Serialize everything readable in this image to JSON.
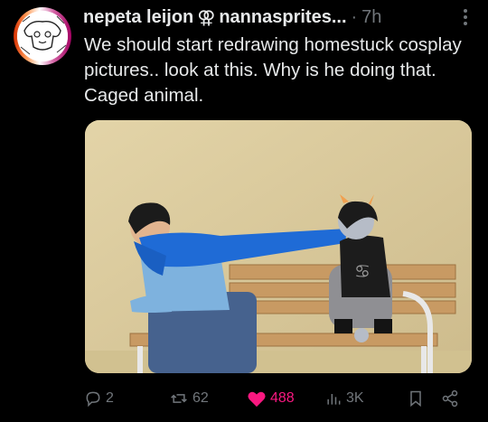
{
  "post": {
    "author_name": "nepeta leijon",
    "author_symbol": "⚢",
    "author_handle": "nannasprites...",
    "separator": "·",
    "time": "7h",
    "text": "We should start redrawing homestuck cosplay pictures.. look at this. Why is he doing that. Caged animal."
  },
  "actions": {
    "replies": {
      "icon": "reply-icon",
      "count": "2"
    },
    "reposts": {
      "icon": "repost-icon",
      "count": "62"
    },
    "likes": {
      "icon": "heart-filled-icon",
      "count": "488",
      "color": "#f91880"
    },
    "views": {
      "icon": "views-icon",
      "count": "3K"
    },
    "bookmark": {
      "icon": "bookmark-icon"
    },
    "share": {
      "icon": "share-icon"
    }
  },
  "colors": {
    "background": "#000000",
    "text": "#e7e9ea",
    "muted": "#71767b",
    "like": "#f91880"
  }
}
